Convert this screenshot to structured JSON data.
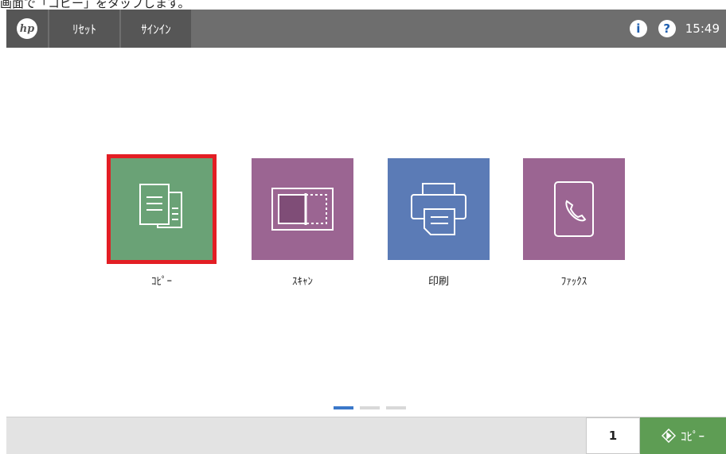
{
  "caption": "画面で「コピー」をタップします。",
  "topbar": {
    "logo": "hp",
    "reset_label": "ﾘｾｯﾄ",
    "signin_label": "ｻｲﾝｲﾝ",
    "info_icon": "i",
    "help_icon": "?",
    "clock": "15:49"
  },
  "apps": [
    {
      "label": "ｺﾋﾟｰ",
      "icon": "copy-icon",
      "color": "#6aa276",
      "selected": true
    },
    {
      "label": "ｽｷｬﾝ",
      "icon": "scan-icon",
      "color": "#9b6592"
    },
    {
      "label": "印刷",
      "icon": "print-icon",
      "color": "#5b7bb6"
    },
    {
      "label": "ﾌｧｯｸｽ",
      "icon": "fax-icon",
      "color": "#9b6592"
    }
  ],
  "pager": {
    "pages": 3,
    "current": 1
  },
  "bottombar": {
    "copies": "1",
    "start_label": "ｺﾋﾟｰ"
  },
  "colors": {
    "topbar": "#6e6e6e",
    "selection": "#e31e24",
    "start": "#5e9d54"
  }
}
